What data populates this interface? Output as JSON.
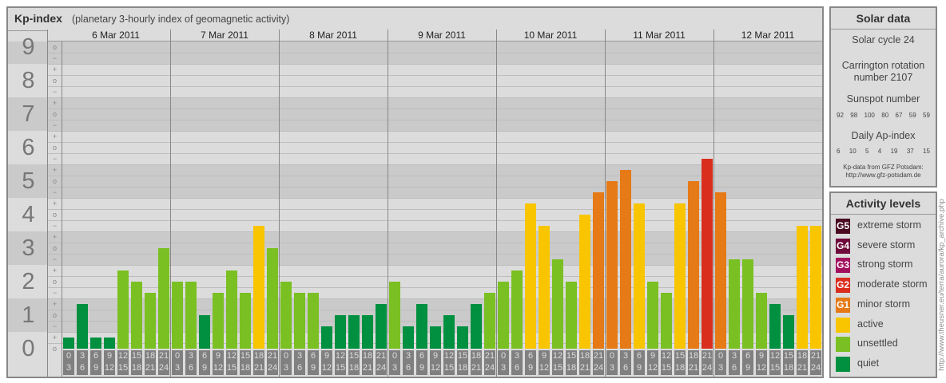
{
  "header": {
    "title": "Kp-index",
    "subtitle": "(planetary 3-hourly index of geomagnetic activity)"
  },
  "chart_data": {
    "type": "bar",
    "title": "Kp-index",
    "ylabel": "Kp",
    "ylim": [
      0,
      9
    ],
    "y_ticks": [
      "0",
      "1",
      "2",
      "3",
      "4",
      "5",
      "6",
      "7",
      "8",
      "9"
    ],
    "sublevel_labels": {
      "minus": "−",
      "zero": "o",
      "plus": "+"
    },
    "days": [
      "6 Mar 2011",
      "7 Mar 2011",
      "8 Mar 2011",
      "9 Mar 2011",
      "10 Mar 2011",
      "11 Mar 2011",
      "12 Mar 2011"
    ],
    "intervals": [
      [
        "0",
        "3"
      ],
      [
        "3",
        "6"
      ],
      [
        "6",
        "9"
      ],
      [
        "9",
        "12"
      ],
      [
        "12",
        "15"
      ],
      [
        "15",
        "18"
      ],
      [
        "18",
        "21"
      ],
      [
        "21",
        "24"
      ]
    ],
    "values": [
      [
        "0+",
        "1+",
        "0+",
        "0+",
        "2+",
        "2o",
        "2-",
        "3o"
      ],
      [
        "2o",
        "2o",
        "1o",
        "2-",
        "2+",
        "2-",
        "4-",
        "3o"
      ],
      [
        "2o",
        "2-",
        "2-",
        "1-",
        "1o",
        "1o",
        "1o",
        "1+"
      ],
      [
        "2o",
        "1-",
        "1+",
        "1-",
        "1o",
        "1-",
        "1+",
        "2-"
      ],
      [
        "2o",
        "2+",
        "4+",
        "4-",
        "3-",
        "2o",
        "4o",
        "5-"
      ],
      [
        "5o",
        "5+",
        "4+",
        "2o",
        "2-",
        "4+",
        "5o",
        "6-"
      ],
      [
        "5-",
        "3-",
        "3-",
        "2-",
        "1+",
        "1o",
        "4-",
        "4-"
      ]
    ]
  },
  "solar": {
    "title": "Solar data",
    "cycle": "Solar cycle 24",
    "carrington_1": "Carrington rotation",
    "carrington_2": "number 2107",
    "sunspot_label": "Sunspot number",
    "sunspots": [
      "92",
      "98",
      "100",
      "80",
      "67",
      "59",
      "59"
    ],
    "ap_label": "Daily Ap-index",
    "ap": [
      "6",
      "10",
      "5",
      "4",
      "19",
      "37",
      "15"
    ],
    "source_1": "Kp-data from GFZ Potsdam:",
    "source_2": "http://www.gfz-potsdam.de"
  },
  "legend": {
    "title": "Activity levels",
    "items": [
      {
        "badge": "G5",
        "label": "extreme storm",
        "color": "#4a0a22"
      },
      {
        "badge": "G4",
        "label": "severe storm",
        "color": "#6e0a3c"
      },
      {
        "badge": "G3",
        "label": "strong storm",
        "color": "#a3105e"
      },
      {
        "badge": "G2",
        "label": "moderate storm",
        "color": "#d92e1e"
      },
      {
        "badge": "G1",
        "label": "minor storm",
        "color": "#e57a17"
      },
      {
        "badge": "",
        "label": "active",
        "color": "#f8c500"
      },
      {
        "badge": "",
        "label": "unsettled",
        "color": "#7ac022"
      },
      {
        "badge": "",
        "label": "quiet",
        "color": "#00903f"
      }
    ]
  },
  "credit_url": "http://www.theusner.eu/terra/aurora/kp_archive.php"
}
